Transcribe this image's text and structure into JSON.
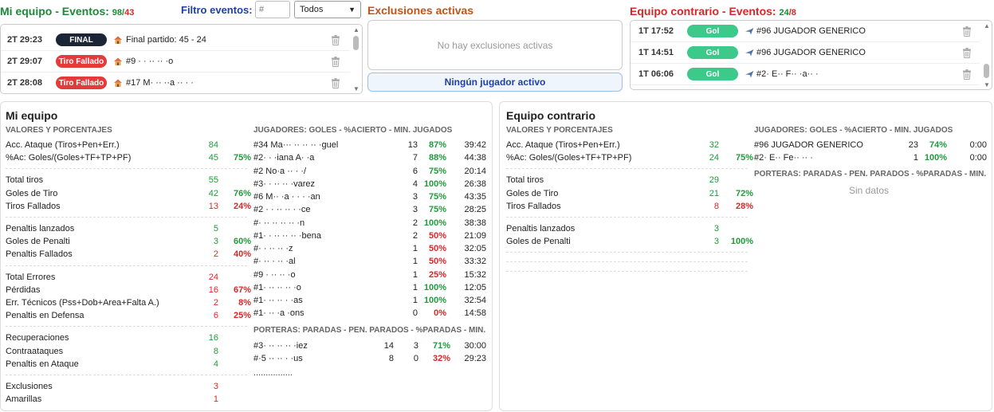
{
  "header": {
    "my_title": "Mi equipo - Eventos:",
    "my_count_a": "98",
    "my_count_b": "43",
    "filter_label": "Filtro eventos:",
    "filter_placeholder": "#",
    "filter_select": "Todos",
    "exclusions_title": "Exclusiones activas",
    "opp_title": "Equipo contrario - Eventos:",
    "opp_count_a": "24",
    "opp_count_b": "8"
  },
  "my_events": [
    {
      "time": "2T 29:23",
      "badge": "FINAL",
      "badge_type": "final",
      "icon": "house-icon",
      "desc": "Final partido: 45 - 24"
    },
    {
      "time": "2T 29:07",
      "badge": "Tiro Fallado",
      "badge_type": "fail",
      "icon": "house-icon",
      "desc": "#9 ·  · ·· ·· ·o"
    },
    {
      "time": "2T 28:08",
      "badge": "Tiro Fallado",
      "badge_type": "fail",
      "icon": "house-icon",
      "desc": "#17 M·  ·· ··a ·· ·  ·"
    }
  ],
  "exclusions": {
    "empty_text": "No hay exclusiones activas",
    "no_player_text": "Ningún jugador activo"
  },
  "opp_events": [
    {
      "time": "1T 17:52",
      "badge": "Gol",
      "badge_type": "gol",
      "icon": "plane-icon",
      "desc": "#96 JUGADOR GENERICO"
    },
    {
      "time": "1T 14:51",
      "badge": "Gol",
      "badge_type": "gol",
      "icon": "plane-icon",
      "desc": "#96 JUGADOR GENERICO"
    },
    {
      "time": "1T 06:06",
      "badge": "Gol",
      "badge_type": "gol",
      "icon": "plane-icon",
      "desc": "#2· E·· F·· ·a·· ·"
    }
  ],
  "my_team": {
    "title": "Mi equipo",
    "values_header": "VALORES Y PORCENTAJES",
    "stats": [
      {
        "label": "Acc. Ataque (Tiros+Pen+Err.)",
        "value": "84",
        "pct": "",
        "vcolor": "green",
        "pcolor": "green",
        "group": 0
      },
      {
        "label": "%Ac: Goles/(Goles+TF+TP+PF)",
        "value": "45",
        "pct": "75%",
        "vcolor": "green",
        "pcolor": "green",
        "group": 0
      },
      {
        "label": "Total tiros",
        "value": "55",
        "pct": "",
        "vcolor": "green",
        "pcolor": "green",
        "group": 1
      },
      {
        "label": "Goles de Tiro",
        "value": "42",
        "pct": "76%",
        "vcolor": "green",
        "pcolor": "green",
        "group": 1
      },
      {
        "label": "Tiros Fallados",
        "value": "13",
        "pct": "24%",
        "vcolor": "red",
        "pcolor": "red",
        "group": 1
      },
      {
        "label": "Penaltis lanzados",
        "value": "5",
        "pct": "",
        "vcolor": "green",
        "pcolor": "green",
        "group": 2
      },
      {
        "label": "Goles de Penalti",
        "value": "3",
        "pct": "60%",
        "vcolor": "green",
        "pcolor": "green",
        "group": 2
      },
      {
        "label": "Penaltis Fallados",
        "value": "2",
        "pct": "40%",
        "vcolor": "red",
        "pcolor": "red",
        "group": 2
      },
      {
        "label": "Total Errores",
        "value": "24",
        "pct": "",
        "vcolor": "red",
        "pcolor": "red",
        "group": 3
      },
      {
        "label": "Pérdidas",
        "value": "16",
        "pct": "67%",
        "vcolor": "red",
        "pcolor": "red",
        "group": 3
      },
      {
        "label": "Err. Técnicos (Pss+Dob+Area+Falta A.)",
        "value": "2",
        "pct": "8%",
        "vcolor": "red",
        "pcolor": "red",
        "group": 3
      },
      {
        "label": "Penaltis en Defensa",
        "value": "6",
        "pct": "25%",
        "vcolor": "red",
        "pcolor": "red",
        "group": 3
      },
      {
        "label": "Recuperaciones",
        "value": "16",
        "pct": "",
        "vcolor": "green",
        "pcolor": "green",
        "group": 4
      },
      {
        "label": "Contraataques",
        "value": "8",
        "pct": "",
        "vcolor": "green",
        "pcolor": "green",
        "group": 4
      },
      {
        "label": "Penaltis en Ataque",
        "value": "4",
        "pct": "",
        "vcolor": "green",
        "pcolor": "green",
        "group": 4
      },
      {
        "label": "Exclusiones",
        "value": "3",
        "pct": "",
        "vcolor": "red",
        "pcolor": "red",
        "group": 5
      },
      {
        "label": "Amarillas",
        "value": "1",
        "pct": "",
        "vcolor": "red",
        "pcolor": "red",
        "group": 5
      }
    ],
    "players_header": "JUGADORES: GOLES - %ACIERTO - MIN. JUGADOS",
    "players": [
      {
        "name": "#34 Ma··· ·· ·· ·· ·guel",
        "goals": "13",
        "pct": "87%",
        "pcolor": "green",
        "min": "39:42"
      },
      {
        "name": "#2· ·  ·iana A· ·a",
        "goals": "7",
        "pct": "88%",
        "pcolor": "green",
        "min": "44:38"
      },
      {
        "name": "#2 No·a ·· ·  ·/",
        "goals": "6",
        "pct": "75%",
        "pcolor": "green",
        "min": "20:14"
      },
      {
        "name": "#3· ·  ·· ·· ·varez",
        "goals": "4",
        "pct": "100%",
        "pcolor": "green",
        "min": "26:38"
      },
      {
        "name": "#6 M·· ·a · · ·  ·an",
        "goals": "3",
        "pct": "75%",
        "pcolor": "green",
        "min": "43:35"
      },
      {
        "name": "#2 · ·  ·· ·· ·  ·ce",
        "goals": "3",
        "pct": "75%",
        "pcolor": "green",
        "min": "28:25"
      },
      {
        "name": "#· ·· ·· ·· ·· ·n",
        "goals": "2",
        "pct": "100%",
        "pcolor": "green",
        "min": "38:38"
      },
      {
        "name": "#1· · ·· ·· ·· ·bena",
        "goals": "2",
        "pct": "50%",
        "pcolor": "red",
        "min": "21:09"
      },
      {
        "name": "#· ·  ·· ·· ·z",
        "goals": "1",
        "pct": "50%",
        "pcolor": "red",
        "min": "32:05"
      },
      {
        "name": "#· ·· ·  ·· ·al",
        "goals": "1",
        "pct": "50%",
        "pcolor": "red",
        "min": "33:32"
      },
      {
        "name": "#9 · ·· ·· ·o",
        "goals": "1",
        "pct": "25%",
        "pcolor": "red",
        "min": "15:32"
      },
      {
        "name": "#1· ·· ·· ·· ·o",
        "goals": "1",
        "pct": "100%",
        "pcolor": "green",
        "min": "12:05"
      },
      {
        "name": "#1· ·· ·· ·  ·as",
        "goals": "1",
        "pct": "100%",
        "pcolor": "green",
        "min": "32:54"
      },
      {
        "name": "#1· ·· ·a ·ons",
        "goals": "0",
        "pct": "0%",
        "pcolor": "red",
        "min": "14:58"
      }
    ],
    "gk_header": "PORTERAS: PARADAS - PEN. PARADOS - %PARADAS - MIN.",
    "goalkeepers": [
      {
        "name": "#3· ·· ·· ·· ·iez",
        "saves": "14",
        "pen": "3",
        "pct": "71%",
        "pcolor": "green",
        "min": "30:00"
      },
      {
        "name": "#·5 ·· ·· ·  ·us",
        "saves": "8",
        "pen": "0",
        "pct": "32%",
        "pcolor": "red",
        "min": "29:23"
      }
    ],
    "dots": "................"
  },
  "opp_team": {
    "title": "Equipo contrario",
    "values_header": "VALORES Y PORCENTAJES",
    "stats": [
      {
        "label": "Acc. Ataque (Tiros+Pen+Err.)",
        "value": "32",
        "pct": "",
        "vcolor": "green",
        "pcolor": "green",
        "group": 0
      },
      {
        "label": "%Ac: Goles/(Goles+TF+TP+PF)",
        "value": "24",
        "pct": "75%",
        "vcolor": "green",
        "pcolor": "green",
        "group": 0
      },
      {
        "label": "Total tiros",
        "value": "29",
        "pct": "",
        "vcolor": "green",
        "pcolor": "green",
        "group": 1
      },
      {
        "label": "Goles de Tiro",
        "value": "21",
        "pct": "72%",
        "vcolor": "green",
        "pcolor": "green",
        "group": 1
      },
      {
        "label": "Tiros Fallados",
        "value": "8",
        "pct": "28%",
        "vcolor": "red",
        "pcolor": "red",
        "group": 1
      },
      {
        "label": "Penaltis lanzados",
        "value": "3",
        "pct": "",
        "vcolor": "green",
        "pcolor": "green",
        "group": 2
      },
      {
        "label": "Goles de Penalti",
        "value": "3",
        "pct": "100%",
        "vcolor": "green",
        "pcolor": "green",
        "group": 2
      }
    ],
    "players_header": "JUGADORES: GOLES - %ACIERTO - MIN. JUGADOS",
    "players": [
      {
        "name": "#96 JUGADOR GENERICO",
        "goals": "23",
        "pct": "74%",
        "pcolor": "green",
        "min": "0:00"
      },
      {
        "name": "#2· E·· Fe·· ·· ·",
        "goals": "1",
        "pct": "100%",
        "pcolor": "green",
        "min": "0:00"
      }
    ],
    "gk_header": "PORTERAS: PARADAS - PEN. PARADOS - %PARADAS - MIN.",
    "gk_empty": "Sin datos"
  },
  "colors": {
    "green": "#1f9a3a",
    "red": "#d62828",
    "badge_final": "#1c2536",
    "badge_fail": "#e33b3b",
    "badge_gol": "#3cc98a",
    "title_blue": "#1f3fa6",
    "exclusions_orange": "#c8511a"
  }
}
